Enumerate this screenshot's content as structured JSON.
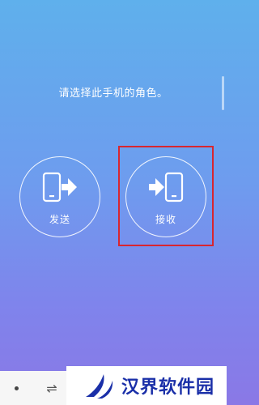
{
  "prompt": "请选择此手机的角色。",
  "roles": {
    "send": {
      "label": "发送",
      "icon": "phone-send-icon"
    },
    "receive": {
      "label": "接收",
      "icon": "phone-receive-icon"
    }
  },
  "navbar": {
    "left_icon": "dot-icon",
    "recent_icon": "recent-apps-icon",
    "recent_glyph": "⇌"
  },
  "watermark": {
    "text": "汉界软件园",
    "logo": "hanjie-logo-icon"
  },
  "colors": {
    "bg_top": "#5fb0ec",
    "bg_bottom": "#8a78e6",
    "highlight": "#d8262f",
    "watermark_text": "#1a2fa8"
  }
}
